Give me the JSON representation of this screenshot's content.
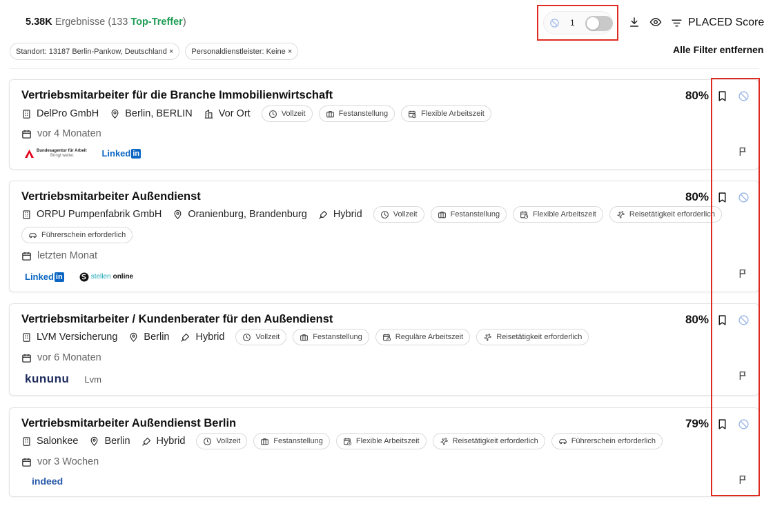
{
  "header": {
    "results_count": "5.38K",
    "results_label": "Ergebnisse",
    "top_open": "(133",
    "top_label": "Top-Treffer",
    "top_close": ")",
    "hidden_count": "1",
    "sort_label": "PLACED Score"
  },
  "filters": {
    "chips": [
      "Standort: 13187 Berlin-Pankow, Deutschland ×",
      "Personaldienstleister: Keine ×"
    ],
    "clear_all": "Alle Filter entfernen"
  },
  "jobs": [
    {
      "title": "Vertriebsmitarbeiter für die Branche Immobilienwirtschaft",
      "score": "80%",
      "company": "DelPro GmbH",
      "location": "Berlin, BERLIN",
      "work_mode": "Vor Ort",
      "tags": [
        "Vollzeit",
        "Festanstellung",
        "Flexible Arbeitszeit"
      ],
      "posted": "vor 4 Monaten",
      "sources": [
        "Bundesagentur für Arbeit",
        "LinkedIn"
      ]
    },
    {
      "title": "Vertriebsmitarbeiter Außendienst",
      "score": "80%",
      "company": "ORPU Pumpenfabrik GmbH",
      "location": "Oranienburg, Brandenburg",
      "work_mode": "Hybrid",
      "tags": [
        "Vollzeit",
        "Festanstellung",
        "Flexible Arbeitszeit",
        "Reisetätigkeit erforderlich",
        "Führerschein erforderlich"
      ],
      "posted": "letzten Monat",
      "sources": [
        "LinkedIn",
        "stellenonline"
      ]
    },
    {
      "title": "Vertriebsmitarbeiter / Kundenberater für den Außendienst",
      "score": "80%",
      "company": "LVM Versicherung",
      "location": "Berlin",
      "work_mode": "Hybrid",
      "tags": [
        "Vollzeit",
        "Festanstellung",
        "Reguläre Arbeitszeit",
        "Reisetätigkeit erforderlich"
      ],
      "posted": "vor 6 Monaten",
      "sources": [
        "kununu",
        "Lvm"
      ]
    },
    {
      "title": "Vertriebsmitarbeiter Außendienst Berlin",
      "score": "79%",
      "company": "Salonkee",
      "location": "Berlin",
      "work_mode": "Hybrid",
      "tags": [
        "Vollzeit",
        "Festanstellung",
        "Flexible Arbeitszeit",
        "Reisetätigkeit erforderlich",
        "Führerschein erforderlich"
      ],
      "posted": "vor 3 Wochen",
      "sources": [
        "indeed"
      ]
    }
  ],
  "logo_text": {
    "ba_line1": "Bundesagentur für Arbeit",
    "ba_line2": "Bringt weiter.",
    "linkedin_word": "Linked",
    "linkedin_in": "in",
    "so_part1": "stellen",
    "so_part2": "online",
    "kununu": "kununu",
    "lvm": "Lvm",
    "indeed": "indeed"
  },
  "colors": {
    "highlight": "#e02a1f",
    "top_hits": "#1f9d55",
    "hide_icon": "#9db8e8",
    "linkedin": "#0a66c2"
  }
}
